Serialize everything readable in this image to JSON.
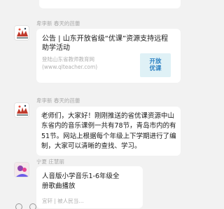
{
  "messages": [
    {
      "sender": "卑李新  春天的芭蕾",
      "card_title": "公告 | 山东开放省级“优课”资源支持远程助学活动",
      "card_desc": "登陆山东省教师教育网 (www.qlteacher.com)",
      "thumb_text": "开放\n优课"
    },
    {
      "sender": "卑李新  春天的芭蕾",
      "text": "老师们，大家好！刚刚推送的省优课资源中山东省内的音乐课例一共有78节，青岛市内的有51节。网站上根据每个年级上下学期进行了编制，大家可以清晰的查找、学习。"
    },
    {
      "sender": "宁夏  庄慧丽",
      "card_title": "人音版小学音乐1-6年级全册歌曲播放",
      "card_source": "宜轩 | 被人民当…"
    }
  ],
  "colors": {
    "background": "#f2f2f2",
    "bubble": "#ffffff",
    "sender": "#a8a8a8",
    "thumb_bg": "#dff1f6",
    "thumb_text": "#2a7fc1"
  },
  "icons": [
    "avatar-icon",
    "reply-icon"
  ]
}
